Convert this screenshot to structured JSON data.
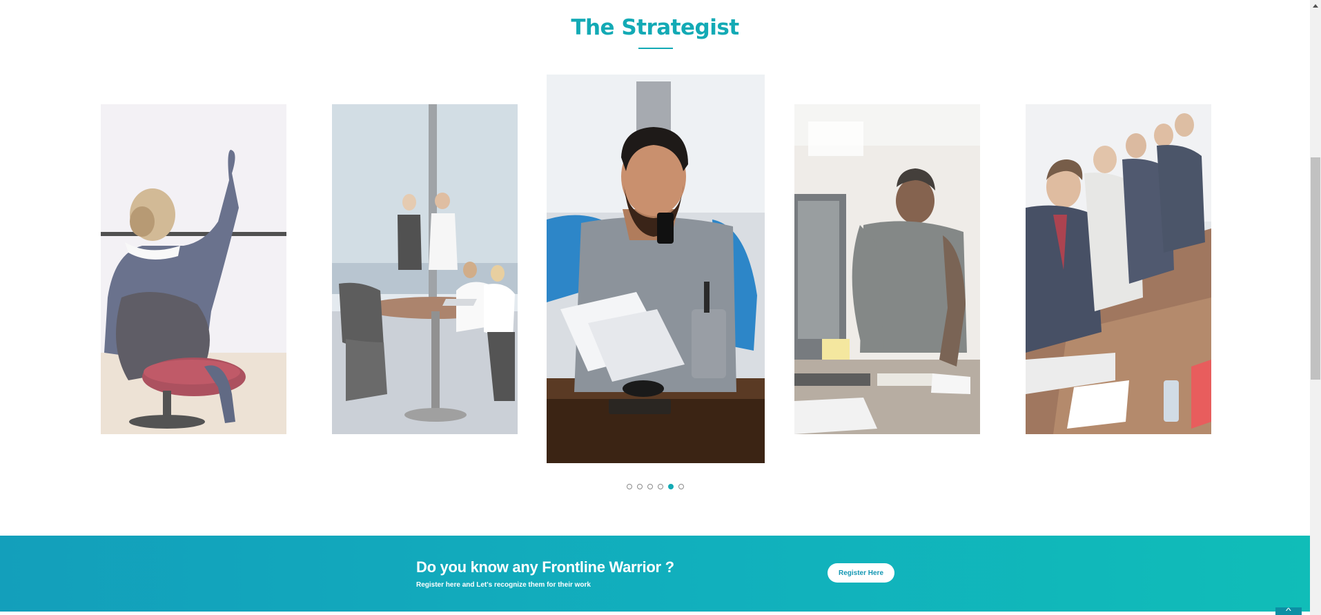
{
  "section": {
    "title": "The Strategist"
  },
  "carousel": {
    "slides": [
      {
        "name": "slide-woman-raising-hand"
      },
      {
        "name": "slide-team-meeting-window"
      },
      {
        "name": "slide-man-on-phone-reading"
      },
      {
        "name": "slide-man-writing-at-desk"
      },
      {
        "name": "slide-conference-table"
      }
    ],
    "dots_count": 6,
    "active_dot": 5
  },
  "banner": {
    "heading": "Do you know any Frontline Warrior ?",
    "subtext": "Register here and Let's recognize them for their work",
    "button_label": "Register Here"
  },
  "colors": {
    "accent": "#13aab5",
    "banner_start": "#139fbb",
    "banner_end": "#10bdb8"
  },
  "icons": {
    "back_to_top": "chevron-up-icon",
    "scroll_up": "triangle-up-icon"
  }
}
